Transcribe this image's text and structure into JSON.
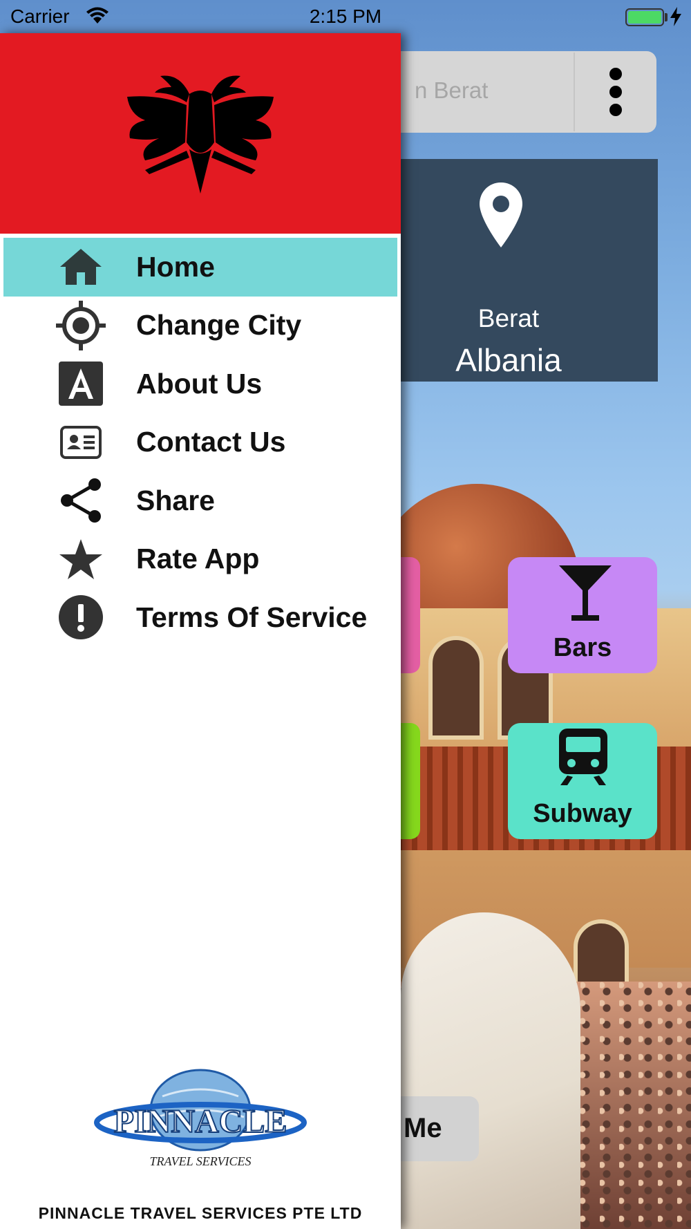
{
  "status_bar": {
    "carrier": "Carrier",
    "time": "2:15 PM"
  },
  "background": {
    "search_placeholder": "Search in Berat",
    "search_visible_text": "n Berat",
    "city_name": "Berat",
    "country_name": "Albania",
    "tiles": [
      {
        "label": "Bars",
        "color": "#c688f5",
        "icon": "cocktail-glass-icon"
      },
      {
        "label": "Subway",
        "color": "#5ae2c9",
        "icon": "subway-train-icon"
      }
    ],
    "partial_tile_colors": [
      "#e45fa4",
      "#86d81d"
    ],
    "bottom_button_label": "Me",
    "card_color": "#34495e"
  },
  "drawer": {
    "header_flag": {
      "background": "#e31a22",
      "emblem": "double-headed-eagle"
    },
    "menu": [
      {
        "label": "Home",
        "icon": "home-icon",
        "active": true
      },
      {
        "label": "Change City",
        "icon": "crosshair-icon",
        "active": false
      },
      {
        "label": "About Us",
        "icon": "about-letter-a-icon",
        "active": false
      },
      {
        "label": "Contact Us",
        "icon": "contact-card-icon",
        "active": false
      },
      {
        "label": "Share",
        "icon": "share-icon",
        "active": false
      },
      {
        "label": "Rate App",
        "icon": "star-icon",
        "active": false
      },
      {
        "label": "Terms Of Service",
        "icon": "exclamation-circle-icon",
        "active": false
      }
    ],
    "active_color": "#76d7d7",
    "logo_text": "PINNACLE",
    "logo_subtext": "TRAVEL SERVICES",
    "company_name": "PINNACLE TRAVEL SERVICES PTE LTD"
  }
}
